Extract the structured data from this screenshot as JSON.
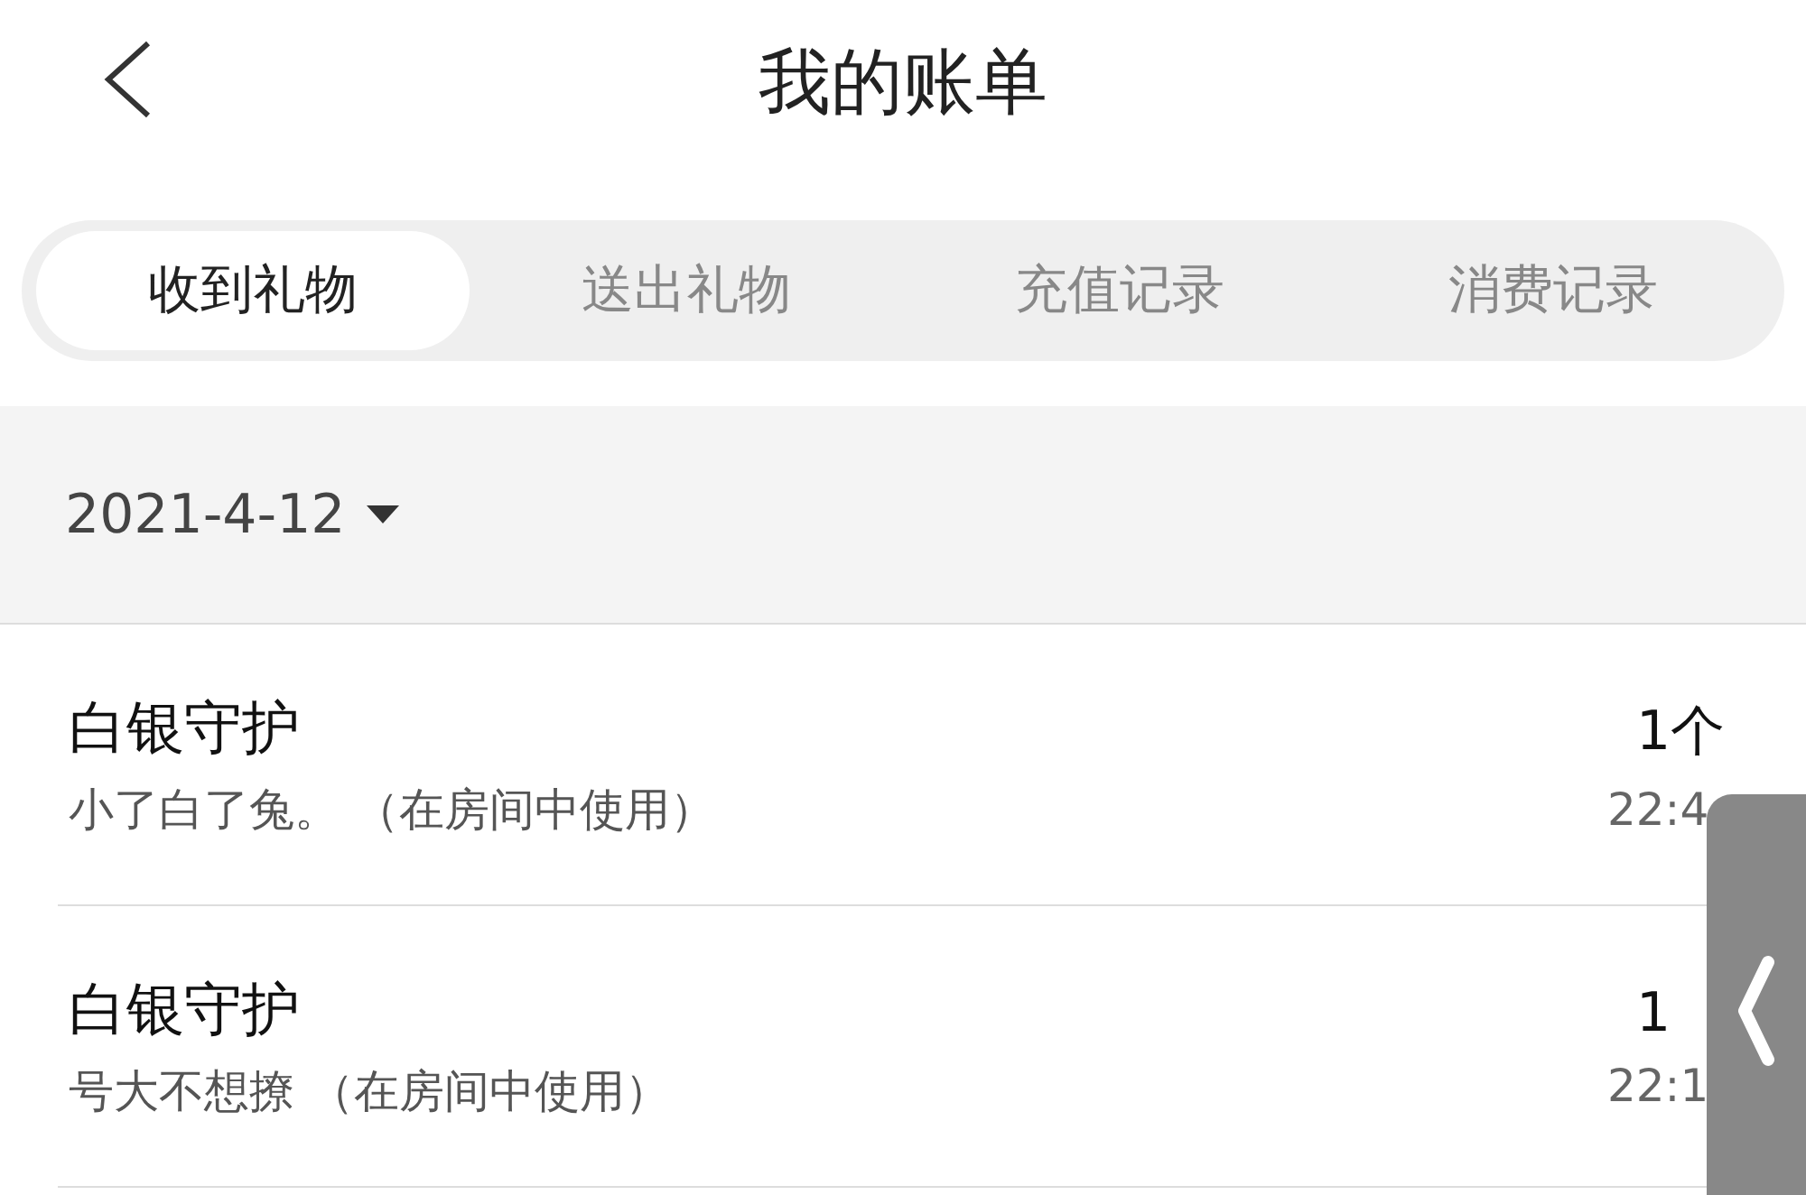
{
  "header": {
    "title": "我的账单"
  },
  "tabs": [
    {
      "label": "收到礼物",
      "selected": true
    },
    {
      "label": "送出礼物",
      "selected": false
    },
    {
      "label": "充值记录",
      "selected": false
    },
    {
      "label": "消费记录",
      "selected": false
    }
  ],
  "date_filter": {
    "value": "2021-4-12"
  },
  "records": [
    {
      "name": "白银守护",
      "detail": "小了白了兔。 （在房间中使用）",
      "amount": "1个",
      "time": "22:4"
    },
    {
      "name": "白银守护",
      "detail": "号大不想撩 （在房间中使用）",
      "amount": "1",
      "time": "22:1"
    }
  ]
}
